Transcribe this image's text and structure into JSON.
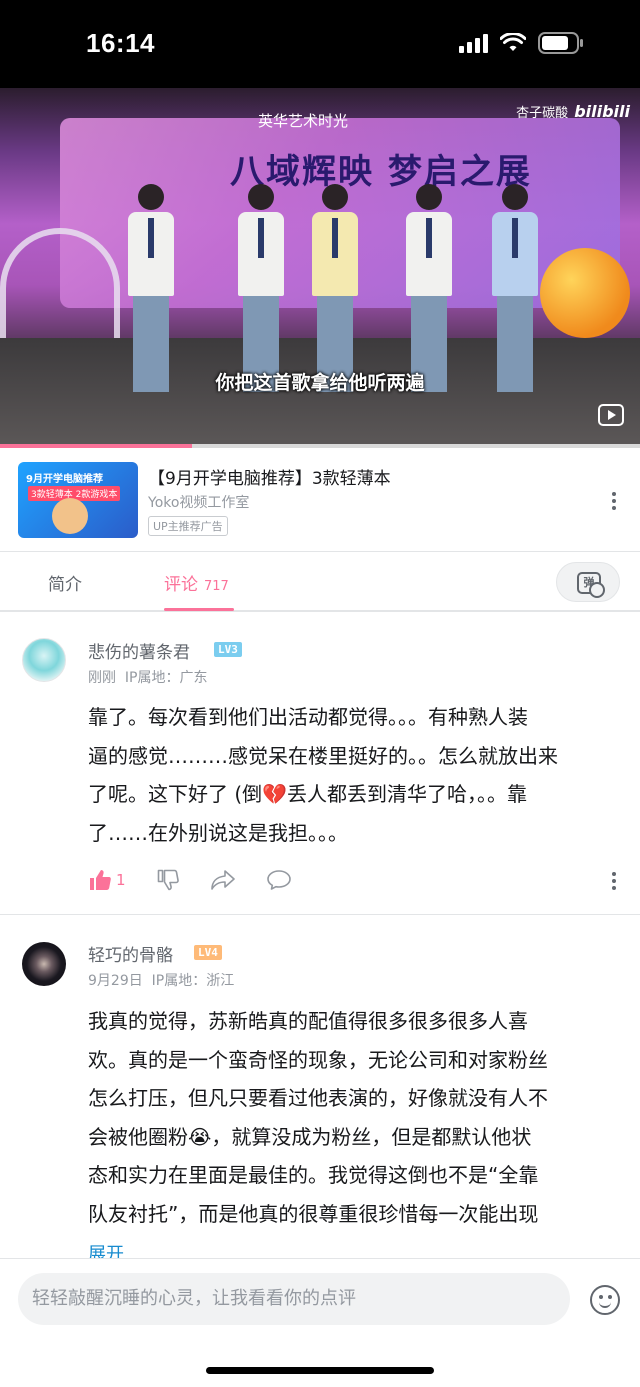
{
  "status_bar": {
    "time": "16:14"
  },
  "video": {
    "subtitle": "你把这首歌拿给他听两遍",
    "watermark_user": "杏子碳酸",
    "watermark_brand": "bilibili",
    "banner_brand": "英华艺术时光",
    "banner_title": "八域辉映 梦启之展",
    "progress": 0.3
  },
  "ad": {
    "title": "【9月开学电脑推荐】3款轻薄本",
    "author": "Yoko视频工作室",
    "badge": "UP主推荐广告",
    "thumb_line1": "9月开学电脑推荐",
    "thumb_line2": "3款轻薄本 2款游戏本"
  },
  "tabs": {
    "intro": "简介",
    "comments": "评论",
    "comments_count": "717",
    "danmaku_icon_text": "弹"
  },
  "comments": [
    {
      "username": "悲伤的薯条君",
      "level": "LV3",
      "time": "刚刚",
      "ip": "IP属地：广东",
      "lines": [
        "靠了。每次看到他们出活动都觉得。。。有种熟人装",
        "逼的感觉………感觉呆在楼里挺好的。。怎么就放出来",
        "了呢。这下好了 (倒💔丢人都丢到清华了哈，。。靠",
        "了……在外别说这是我担。。。"
      ],
      "likes": "1"
    },
    {
      "username": "轻巧的骨骼",
      "level": "LV4",
      "time": "9月29日",
      "ip": "IP属地：浙江",
      "lines": [
        "我真的觉得，苏新皓真的配值得很多很多很多人喜",
        "欢。真的是一个蛮奇怪的现象，无论公司和对家粉丝",
        "怎么打压，但凡只要看过他表演的，好像就没有人不",
        "会被他圈粉😭，就算没成为粉丝，但是都默认他状",
        "态和实力在里面是最佳的。我觉得这倒也不是“全靠",
        "队友衬托”，而是他真的很尊重很珍惜每一次能出现"
      ],
      "expand": "展开"
    }
  ],
  "input": {
    "placeholder": "轻轻敲醒沉睡的心灵，让我看看你的点评"
  },
  "colors": {
    "accent": "#fb7299",
    "link": "#178bcf",
    "lv3": "#7bcdef",
    "lv4": "#feba78"
  }
}
